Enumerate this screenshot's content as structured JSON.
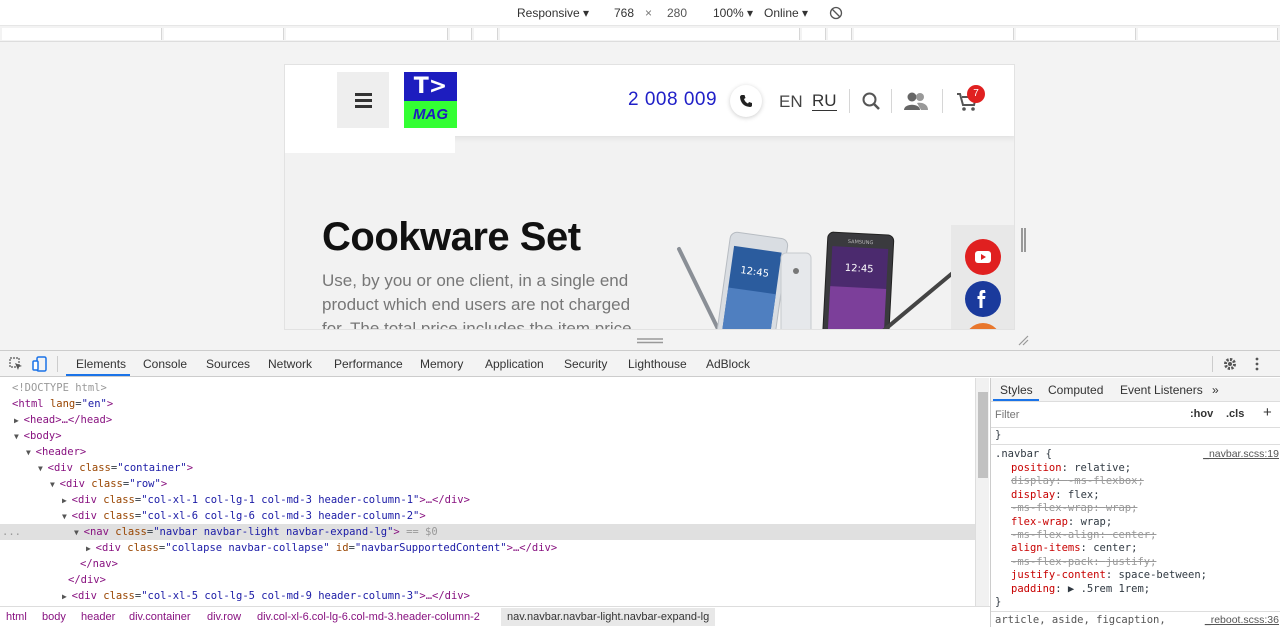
{
  "device_toolbar": {
    "device": "Responsive",
    "width": "768",
    "times": "×",
    "height": "280",
    "zoom": "100%",
    "network": "Online"
  },
  "site": {
    "logo_top": "T>",
    "logo_bottom": "MAG",
    "phone": "2 008 009",
    "lang_en": "EN",
    "lang_ru": "RU",
    "cart_count": "7",
    "hero_title": "Cookware Set",
    "hero_text": "Use, by you or one client, in a single end product which end users are not charged for. The total price includes the item price",
    "phone_screen_time_1": "12:45",
    "phone_screen_time_2": "12:45",
    "phone_brand": "SAMSUNG"
  },
  "devtools": {
    "tabs": [
      "Elements",
      "Console",
      "Sources",
      "Network",
      "Performance",
      "Memory",
      "Application",
      "Security",
      "Lighthouse",
      "AdBlock"
    ],
    "dom": {
      "l1": "<!DOCTYPE html>",
      "l2_tag": "<html",
      "l2_attr": "lang",
      "l2_val": "\"en\"",
      "l3": "<head>…</head>",
      "l4": "<body>",
      "l5": "<header>",
      "l6_val": "\"container\"",
      "l7_val": "\"row\"",
      "l8_val": "\"col-xl-1 col-lg-1 col-md-3 header-column-1\"",
      "l9_val": "\"col-xl-6 col-lg-6 col-md-3 header-column-2\"",
      "l10_val": "\"navbar navbar-light navbar-expand-lg\"",
      "l10_suffix": " == $0",
      "l11_val": "\"collapse navbar-collapse\"",
      "l11_id": "\"navbarSupportedContent\"",
      "l12": "</nav>",
      "l13": "</div>",
      "l14_val": "\"col-xl-5 col-lg-5 col-md-9 header-column-3\"",
      "ellipsis_close": "…</div>",
      "div_open": "<div",
      "nav_open": "<nav",
      "class_attr": "class",
      "id_attr": "id",
      "gt": ">",
      "dots": "..."
    },
    "breadcrumbs": [
      "html",
      "body",
      "header",
      "div.container",
      "div.row",
      "div.col-xl-6.col-lg-6.col-md-3.header-column-2",
      "nav.navbar.navbar-light.navbar-expand-lg"
    ],
    "styles_tabs": [
      "Styles",
      "Computed",
      "Event Listeners",
      "»"
    ],
    "filter_placeholder": "Filter",
    "hov": ":hov",
    "cls": ".cls",
    "plus": "+",
    "brace_close": "}",
    "selector": ".navbar {",
    "source": "_navbar.scss:19",
    "rules": [
      {
        "prop": "position",
        "value": "relative;",
        "struck": false
      },
      {
        "prop": "display",
        "value": "-ms-flexbox;",
        "struck": true
      },
      {
        "prop": "display",
        "value": "flex;",
        "struck": false
      },
      {
        "prop": "-ms-flex-wrap",
        "value": "wrap;",
        "struck": true
      },
      {
        "prop": "flex-wrap",
        "value": "wrap;",
        "struck": false
      },
      {
        "prop": "-ms-flex-align",
        "value": "center;",
        "struck": true
      },
      {
        "prop": "align-items",
        "value": "center;",
        "struck": false
      },
      {
        "prop": "-ms-flex-pack",
        "value": "justify;",
        "struck": true
      },
      {
        "prop": "justify-content",
        "value": "space-between;",
        "struck": false
      },
      {
        "prop": "padding",
        "value": "▶ .5rem 1rem;",
        "struck": false
      }
    ],
    "next_selector": "article, aside, figcaption,",
    "next_source": "_reboot.scss:36"
  },
  "colors": {
    "accent": "#1a73e8",
    "logo_blue": "#1d1dbf",
    "logo_green": "#33ff33",
    "phone_blue": "#2020c8",
    "badge_red": "#e02020",
    "youtube_red": "#e02020",
    "facebook_blue": "#1a3a9c",
    "orange": "#e8762c"
  }
}
